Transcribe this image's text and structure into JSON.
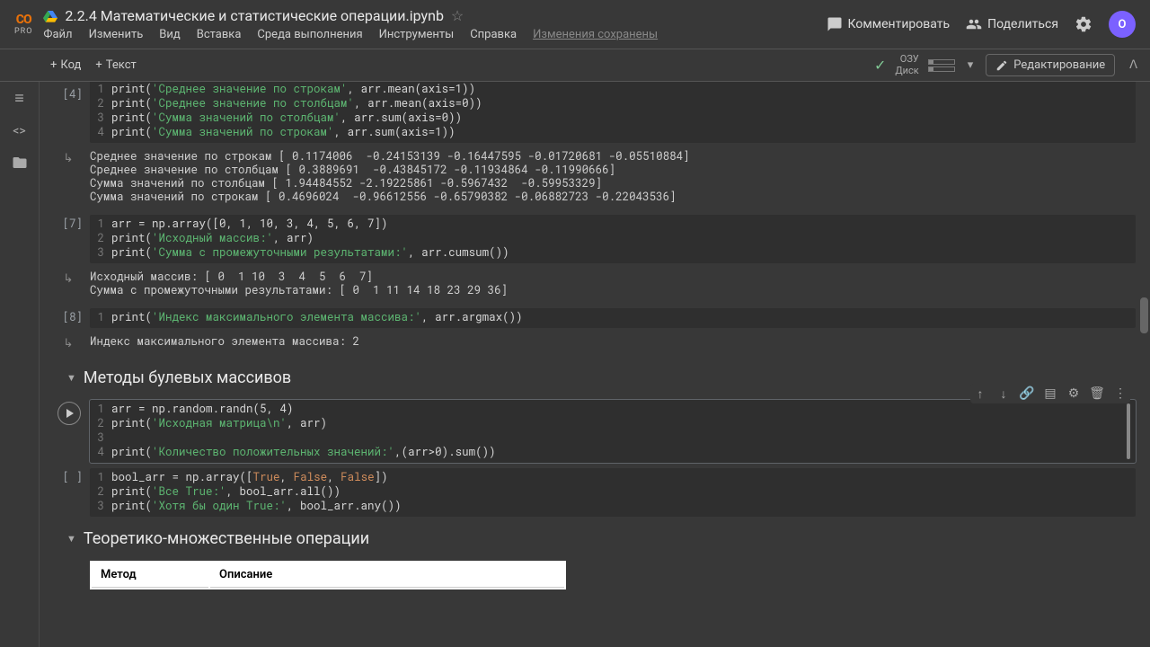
{
  "brand": {
    "top": "CO",
    "sub": "PRO"
  },
  "header": {
    "title": "2.2.4 Математические и статистические операции.ipynb",
    "comment": "Комментировать",
    "share": "Поделиться",
    "avatar": "O"
  },
  "menus": {
    "file": "Файл",
    "edit": "Изменить",
    "view": "Вид",
    "insert": "Вставка",
    "runtime": "Среда выполнения",
    "tools": "Инструменты",
    "help": "Справка",
    "saved": "Изменения сохранены"
  },
  "toolbar": {
    "code": "Код",
    "text": "Текст",
    "ram": "ОЗУ",
    "disk": "Диск",
    "edit": "Редактирование"
  },
  "cells": {
    "c4": {
      "exec": "[4]",
      "l1a": "print(",
      "l1b": "'Среднее значение по строкам'",
      "l1c": ", arr.mean(axis=1))",
      "l2a": "print(",
      "l2b": "'Среднее значение по столбцам'",
      "l2c": ", arr.mean(axis=0))",
      "l3a": "print(",
      "l3b": "'Сумма значений по столбцам'",
      "l3c": ", arr.sum(axis=0))",
      "l4a": "print(",
      "l4b": "'Сумма значений по строкам'",
      "l4c": ", arr.sum(axis=1))",
      "out": "Среднее значение по строкам [ 0.1174006  -0.24153139 -0.16447595 -0.01720681 -0.05510884]\nСреднее значение по столбцам [ 0.3889691  -0.43845172 -0.11934864 -0.11990666]\nСумма значений по столбцам [ 1.94484552 -2.19225861 -0.5967432  -0.59953329]\nСумма значений по строкам [ 0.4696024  -0.96612556 -0.65790382 -0.06882723 -0.22043536]"
    },
    "c7": {
      "exec": "[7]",
      "l1": "arr = np.array([0, 1, 10, 3, 4, 5, 6, 7])",
      "l2a": "print(",
      "l2b": "'Исходный массив:'",
      "l2c": ", arr)",
      "l3a": "print(",
      "l3b": "'Сумма с промежуточными результатами:'",
      "l3c": ", arr.cumsum())",
      "out": "Исходный массив: [ 0  1 10  3  4  5  6  7]\nСумма с промежуточными результатами: [ 0  1 11 14 18 23 29 36]"
    },
    "c8": {
      "exec": "[8]",
      "l1a": "print(",
      "l1b": "'Индекс максимального элемента массива:'",
      "l1c": ", arr.argmax())",
      "out": "Индекс максимального элемента массива: 2"
    },
    "sec1": "Методы булевых массивов",
    "c_active": {
      "l1": "arr = np.random.randn(5, 4)",
      "l2a": "print(",
      "l2b": "'Исходная матрица\\n'",
      "l2c": ", arr)",
      "l4a": "print(",
      "l4b": "'Количество положительных значений:'",
      "l4c": ",(arr>0).sum())"
    },
    "c_empty": {
      "exec": "[ ]",
      "l1a": "bool_arr = np.array([",
      "l1t1": "True",
      "l1c1": ", ",
      "l1f1": "False",
      "l1c2": ", ",
      "l1f2": "False",
      "l1e": "])",
      "l2a": "print(",
      "l2b": "'Все True:'",
      "l2c": ", bool_arr.all())",
      "l3a": "print(",
      "l3b": "'Хотя бы один True:'",
      "l3c": ", bool_arr.any())"
    },
    "sec2": "Теоретико-множественные операции",
    "table": {
      "h1": "Метод",
      "h2": "Описание"
    }
  }
}
